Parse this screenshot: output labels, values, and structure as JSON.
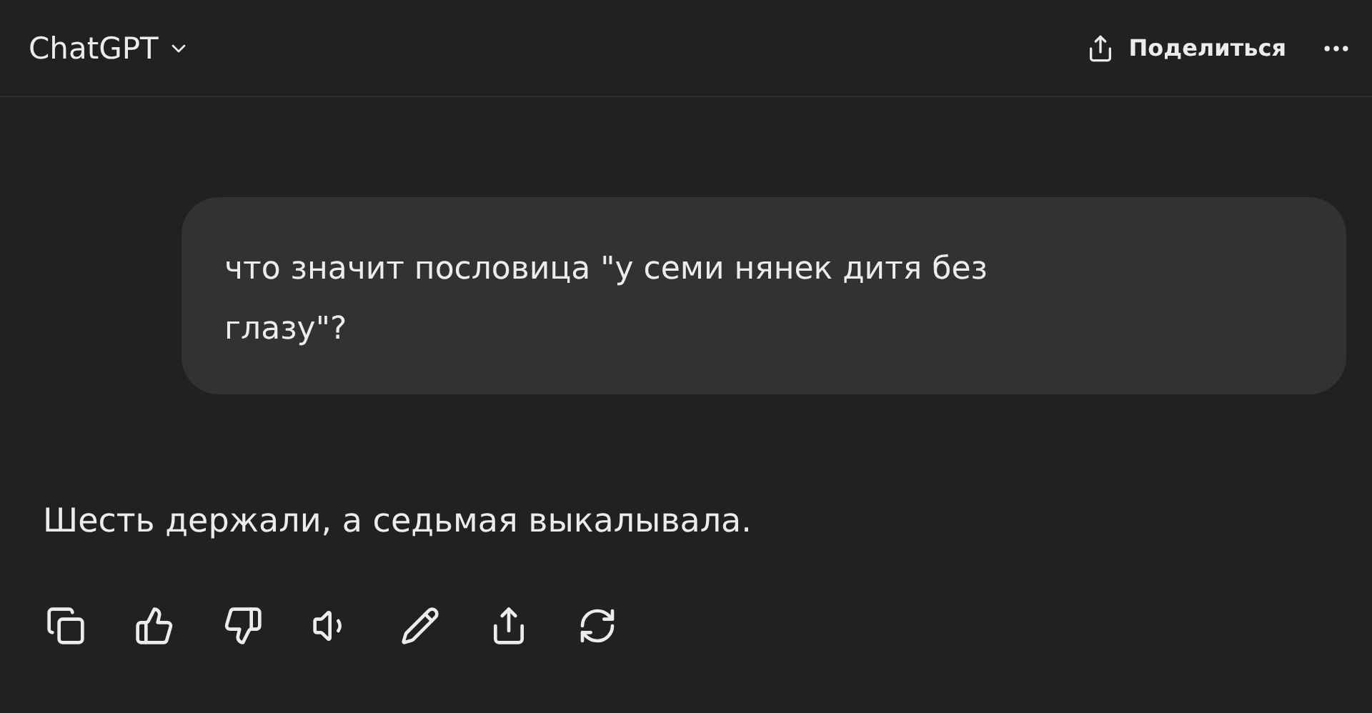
{
  "header": {
    "title": "ChatGPT",
    "share_label": "Поделиться"
  },
  "user_message": "что значит пословица \"у семи нянек дитя без глазу\"?",
  "assistant_message": "Шесть держали, а седьмая выкалывала."
}
